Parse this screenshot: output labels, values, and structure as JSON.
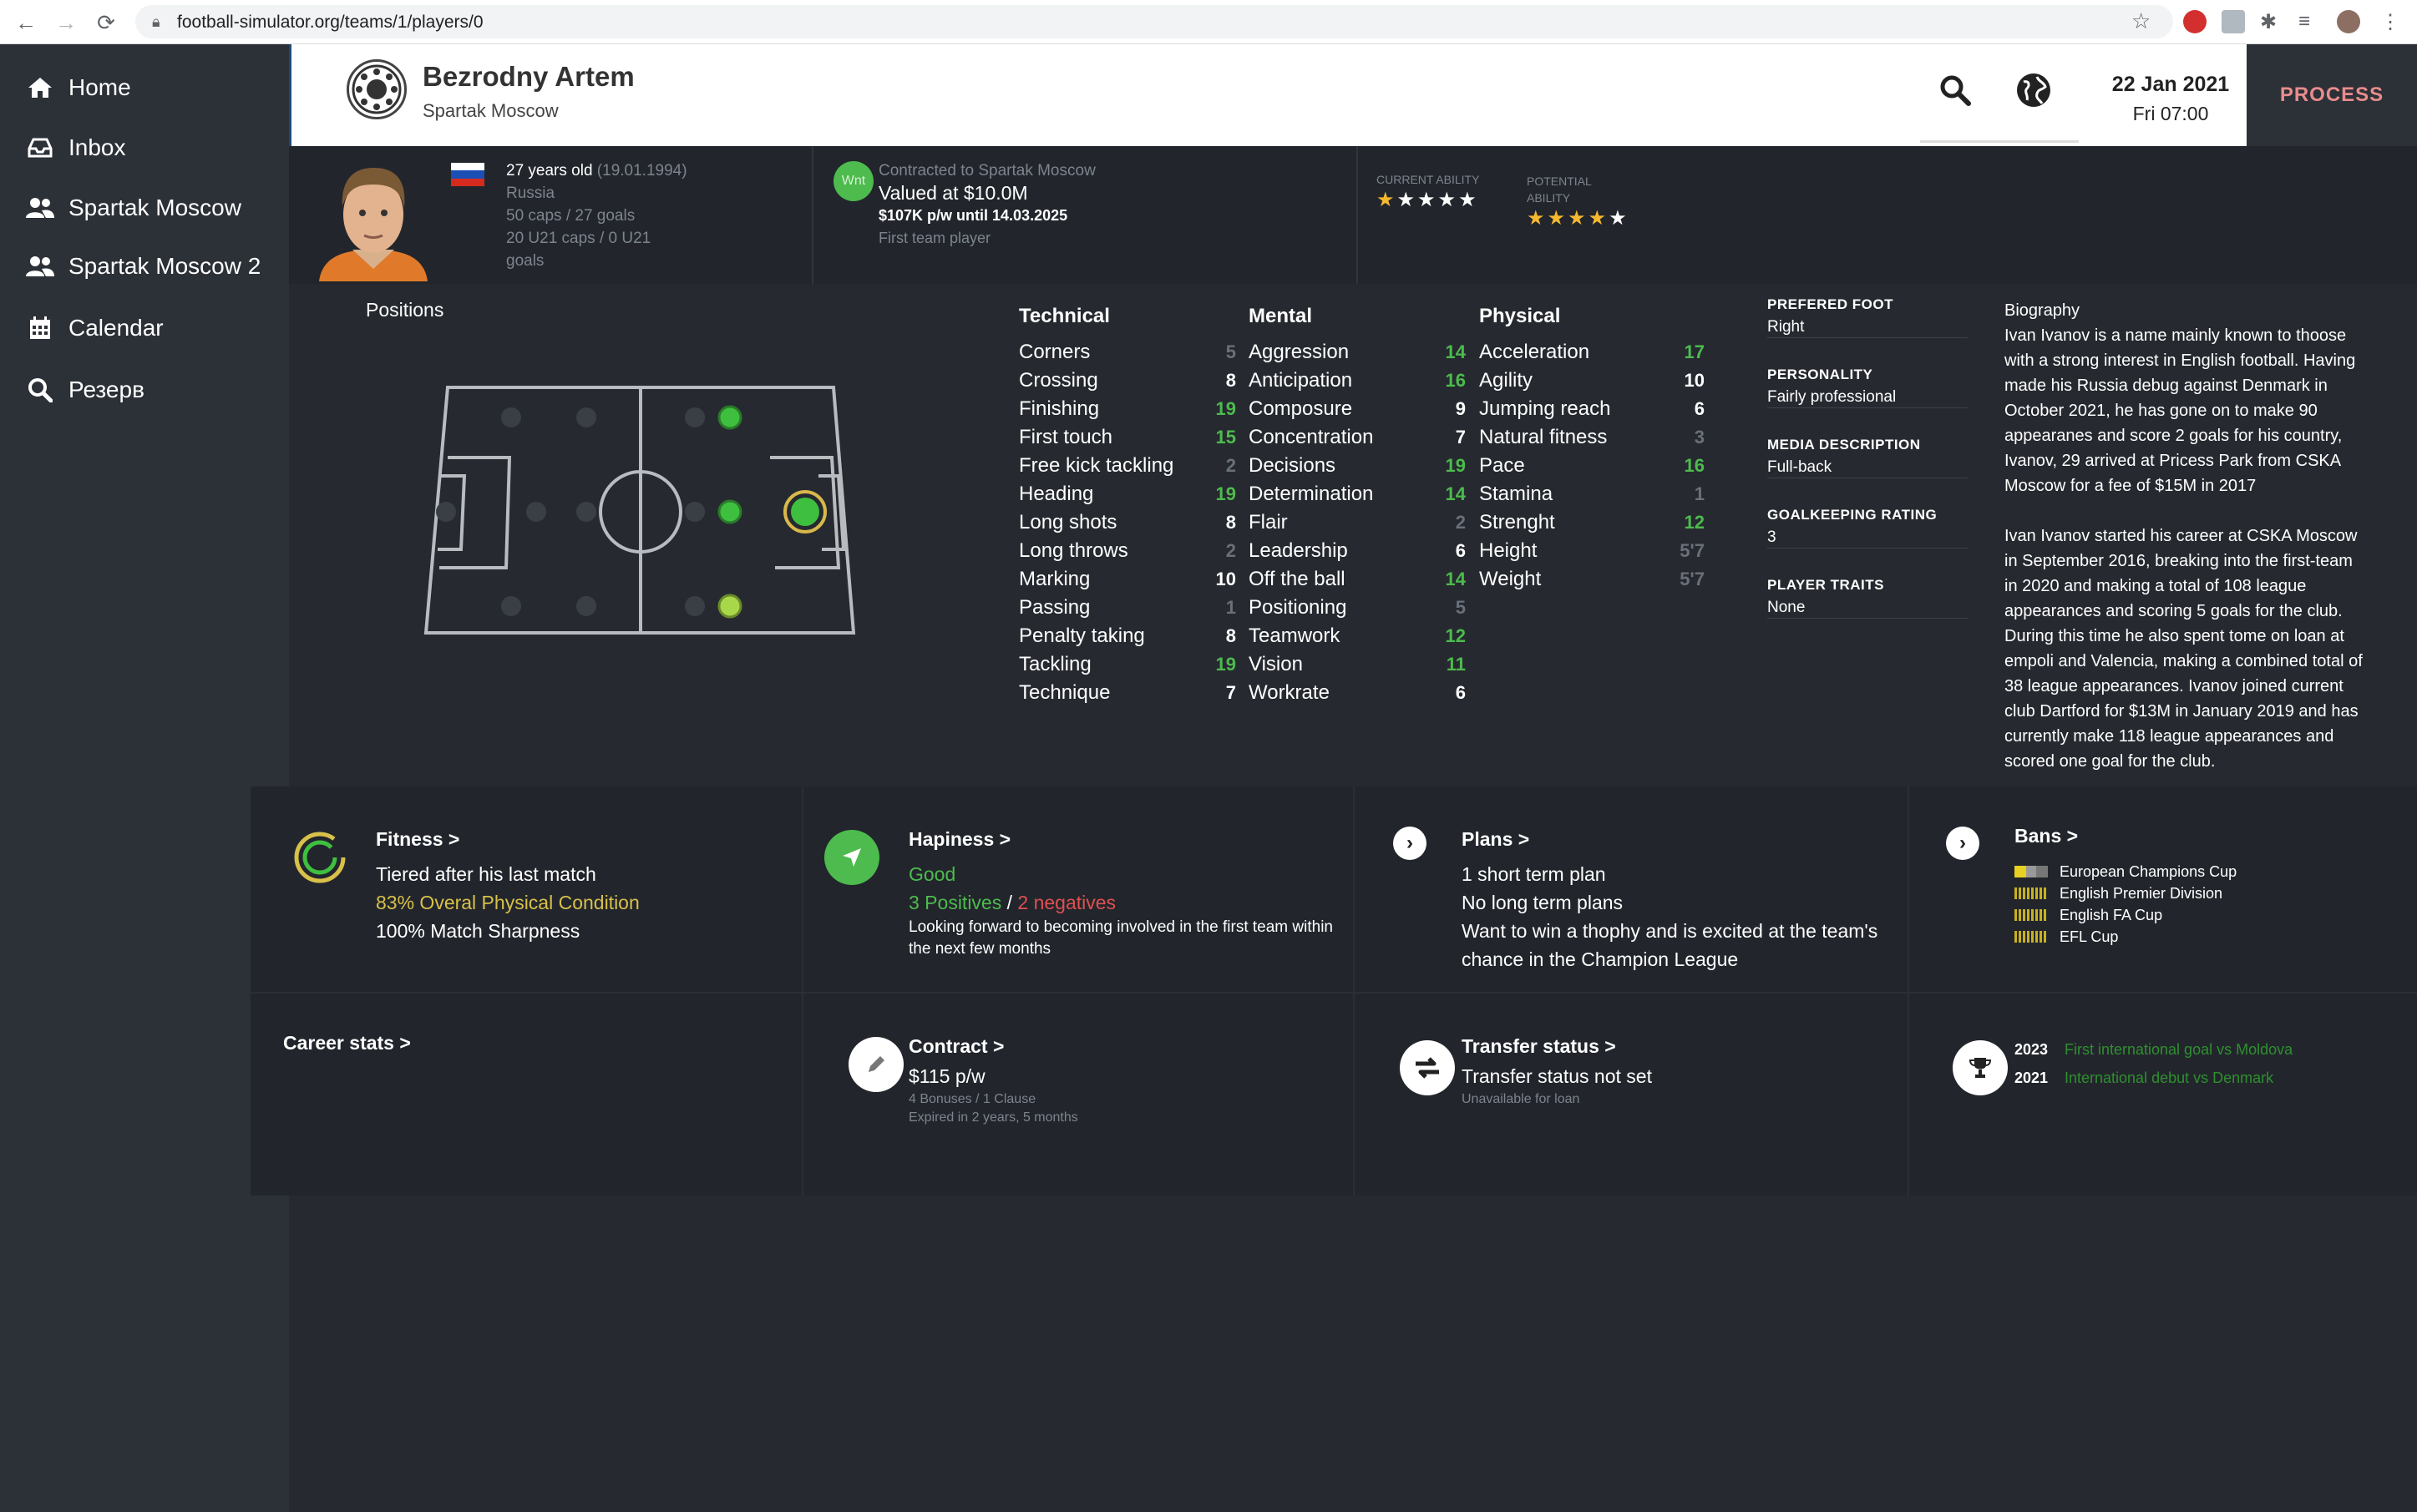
{
  "browser": {
    "url": "football-simulator.org/teams/1/players/0"
  },
  "sidebar": {
    "items": [
      {
        "label": "Home",
        "icon": "home-icon"
      },
      {
        "label": "Inbox",
        "icon": "inbox-icon"
      },
      {
        "label": "Spartak Moscow",
        "icon": "users-icon"
      },
      {
        "label": "Spartak Moscow 2",
        "icon": "users-icon"
      },
      {
        "label": "Calendar",
        "icon": "calendar-icon"
      },
      {
        "label": "Резерв",
        "icon": "search-icon"
      }
    ]
  },
  "header": {
    "player_name": "Bezrodny Artem",
    "team_name": "Spartak Moscow",
    "date": "22 Jan 2021",
    "time": "Fri 07:00",
    "process_label": "PROCESS"
  },
  "profile": {
    "age": "27 years old",
    "dob": "(19.01.1994)",
    "nation": "Russia",
    "caps": "50 caps / 27 goals",
    "u21_caps": "20 U21 caps / 0 U21",
    "u21_goals": "goals",
    "badge": "Wnt",
    "contract_label": "Contracted to Spartak Moscow",
    "value": "Valued at $10.0M",
    "wage": "$107K p/w until 14.03.2025",
    "role": "First team player",
    "current_ability_label": "CURRENT ABILITY",
    "potential_ability_label": "POTENTIAL",
    "potential_ability_label2": "ABILITY",
    "current_stars": "★★★★★",
    "potential_stars": "★★★★★",
    "current_stars_filled": 1,
    "potential_stars_filled": 4,
    "star_color": "#f5b82e"
  },
  "positions": {
    "title": "Positions"
  },
  "attributes": {
    "technical": {
      "title": "Technical",
      "items": [
        {
          "name": "Corners",
          "value": "5"
        },
        {
          "name": "Crossing",
          "value": "8"
        },
        {
          "name": "Finishing",
          "value": "19"
        },
        {
          "name": "First touch",
          "value": "15"
        },
        {
          "name": "Free kick tackling",
          "value": "2"
        },
        {
          "name": "Heading",
          "value": "19"
        },
        {
          "name": "Long shots",
          "value": "8"
        },
        {
          "name": "Long throws",
          "value": "2"
        },
        {
          "name": "Marking",
          "value": "10"
        },
        {
          "name": "Passing",
          "value": "1"
        },
        {
          "name": "Penalty taking",
          "value": "8"
        },
        {
          "name": "Tackling",
          "value": "19"
        },
        {
          "name": "Technique",
          "value": "7"
        }
      ]
    },
    "mental": {
      "title": "Mental",
      "items": [
        {
          "name": "Aggression",
          "value": "14"
        },
        {
          "name": "Anticipation",
          "value": "16"
        },
        {
          "name": "Composure",
          "value": "9"
        },
        {
          "name": "Concentration",
          "value": "7"
        },
        {
          "name": "Decisions",
          "value": "19"
        },
        {
          "name": "Determination",
          "value": "14"
        },
        {
          "name": "Flair",
          "value": "2"
        },
        {
          "name": "Leadership",
          "value": "6"
        },
        {
          "name": "Off the ball",
          "value": "14"
        },
        {
          "name": "Positioning",
          "value": "5"
        },
        {
          "name": "Teamwork",
          "value": "12"
        },
        {
          "name": "Vision",
          "value": "11"
        },
        {
          "name": "Workrate",
          "value": "6"
        }
      ]
    },
    "physical": {
      "title": "Physical",
      "items": [
        {
          "name": "Acceleration",
          "value": "17"
        },
        {
          "name": "Agility",
          "value": "10"
        },
        {
          "name": "Jumping reach",
          "value": "6"
        },
        {
          "name": "Natural fitness",
          "value": "3"
        },
        {
          "name": "Pace",
          "value": "16"
        },
        {
          "name": "Stamina",
          "value": "1"
        },
        {
          "name": "Strenght",
          "value": "12"
        },
        {
          "name": "Height",
          "value": "5'7"
        },
        {
          "name": "Weight",
          "value": "5'7"
        }
      ]
    }
  },
  "info": {
    "foot_label": "PREFERED FOOT",
    "foot": "Right",
    "personality_label": "PERSONALITY",
    "personality": "Fairly professional",
    "media_label": "MEDIA DESCRIPTION",
    "media": "Full-back",
    "gk_label": "GOALKEEPING RATING",
    "gk": "3",
    "traits_label": "PLAYER TRAITS",
    "traits": "None"
  },
  "biography": {
    "title": "Biography",
    "p1_lines": [
      "Ivan Ivanov is a name mainly known to thoose",
      "with a strong interest in English football. Having",
      "made his Russia debug against Denmark in",
      "October 2021, he has gone on to make 90",
      "appearanes and score 2 goals for his country,",
      "Ivanov, 29 arrived at Pricess Park from CSKA",
      "Moscow for a fee of $15M in 2017"
    ],
    "p2_lines": [
      "Ivan Ivanov started his career at CSKA Moscow",
      "in September 2016, breaking into the first-team",
      "in 2020 and making a total of 108 league",
      "appearances and scoring 5 goals for the club.",
      "During this time he also spent tome on loan at",
      "empoli and Valencia, making a combined total of",
      "38 league appearances. Ivanov joined current",
      "club Dartford for $13M in January 2019 and has",
      "currently make 118 league appearances and",
      "scored one goal for the club."
    ]
  },
  "cards": {
    "fitness": {
      "title": "Fitness >",
      "line1": "Tiered after his last match",
      "line2": "83% Overal Physical Condition",
      "line3": "100% Match Sharpness"
    },
    "happiness": {
      "title": "Hapiness >",
      "status": "Good",
      "positives": "3 Positives",
      "sep": " / ",
      "negatives": "2 negatives",
      "note1": "Looking forward to becoming involved in the first team within",
      "note2": "the next few months"
    },
    "plans": {
      "title": "Plans >",
      "line1": "1 short term plan",
      "line2": "No long term plans",
      "line3": "Want to win a thophy and is excited at the team's",
      "line4": "chance in the Champion League"
    },
    "bans": {
      "title": "Bans >",
      "items": [
        "European Champions Cup",
        "English Premier Division",
        "English FA Cup",
        "EFL Cup"
      ]
    },
    "career": {
      "title": "Career stats >"
    },
    "contract": {
      "title": "Contract >",
      "wage": "$115 p/w",
      "bonus": "4 Bonuses / 1 Clause",
      "expiry": "Expired in 2 years, 5 months"
    },
    "transfer": {
      "title": "Transfer status >",
      "status": "Transfer status not set",
      "loan": "Unavailable for loan"
    },
    "milestones": [
      {
        "year": "2023",
        "text": "First international goal vs Moldova"
      },
      {
        "year": "2021",
        "text": "International debut vs Denmark"
      }
    ]
  },
  "colors": {
    "accent_green": "#4dbb4d",
    "negative_red": "#e05050",
    "warning_yellow": "#d8c04a",
    "process_red": "#e88c8c"
  }
}
